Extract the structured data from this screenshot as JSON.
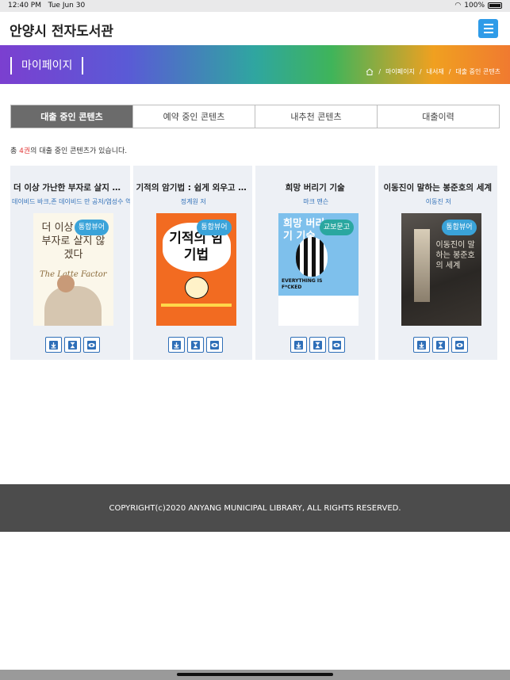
{
  "status": {
    "time": "12:40 PM",
    "date": "Tue Jun 30",
    "battery": "100%"
  },
  "header": {
    "title": "안양시 전자도서관"
  },
  "banner": {
    "title": "마이페이지",
    "breadcrumb": [
      "마이페이지",
      "내서재",
      "대출 중인 콘텐츠"
    ]
  },
  "tabs": [
    {
      "label": "대출 중인 콘텐츠",
      "active": true
    },
    {
      "label": "예약 중인 콘텐츠",
      "active": false
    },
    {
      "label": "내추천 콘텐츠",
      "active": false
    },
    {
      "label": "대출이력",
      "active": false
    }
  ],
  "summary": {
    "prefix": "총 ",
    "count": "4권",
    "suffix": "의 대출 중인 콘텐츠가 있습니다."
  },
  "books": [
    {
      "title": "더 이상 가난한 부자로 살지 않겠다",
      "author": "데이비드 바크,존 데이비드 만 공저/염성수 역",
      "badge": "통합뷰어",
      "cover_text": "더 이상 가난한 부자로 살지 않겠다",
      "cover_sub": "The Latte Factor"
    },
    {
      "title": "기적의 암기법 : 쉽게 외우고 오래 기억하는",
      "author": "정계원 저",
      "badge": "통합뷰어",
      "cover_text": "기적의 암기법",
      "cover_sub": ""
    },
    {
      "title": "희망 버리기 기술",
      "author": "마크 맨슨",
      "badge": "교보문고",
      "cover_text": "희망 버리기 기술",
      "cover_sub": "EVERYTHING IS F*CKED"
    },
    {
      "title": "이동진이 말하는 봉준호의 세계",
      "author": "이동진 저",
      "badge": "통합뷰어",
      "cover_text": "이동진이 말하는 봉준호의 세계",
      "cover_sub": ""
    }
  ],
  "footer": {
    "copyright": "COPYRIGHT(c)2020 ANYANG MUNICIPAL LIBRARY, ALL RIGHTS RESERVED."
  }
}
